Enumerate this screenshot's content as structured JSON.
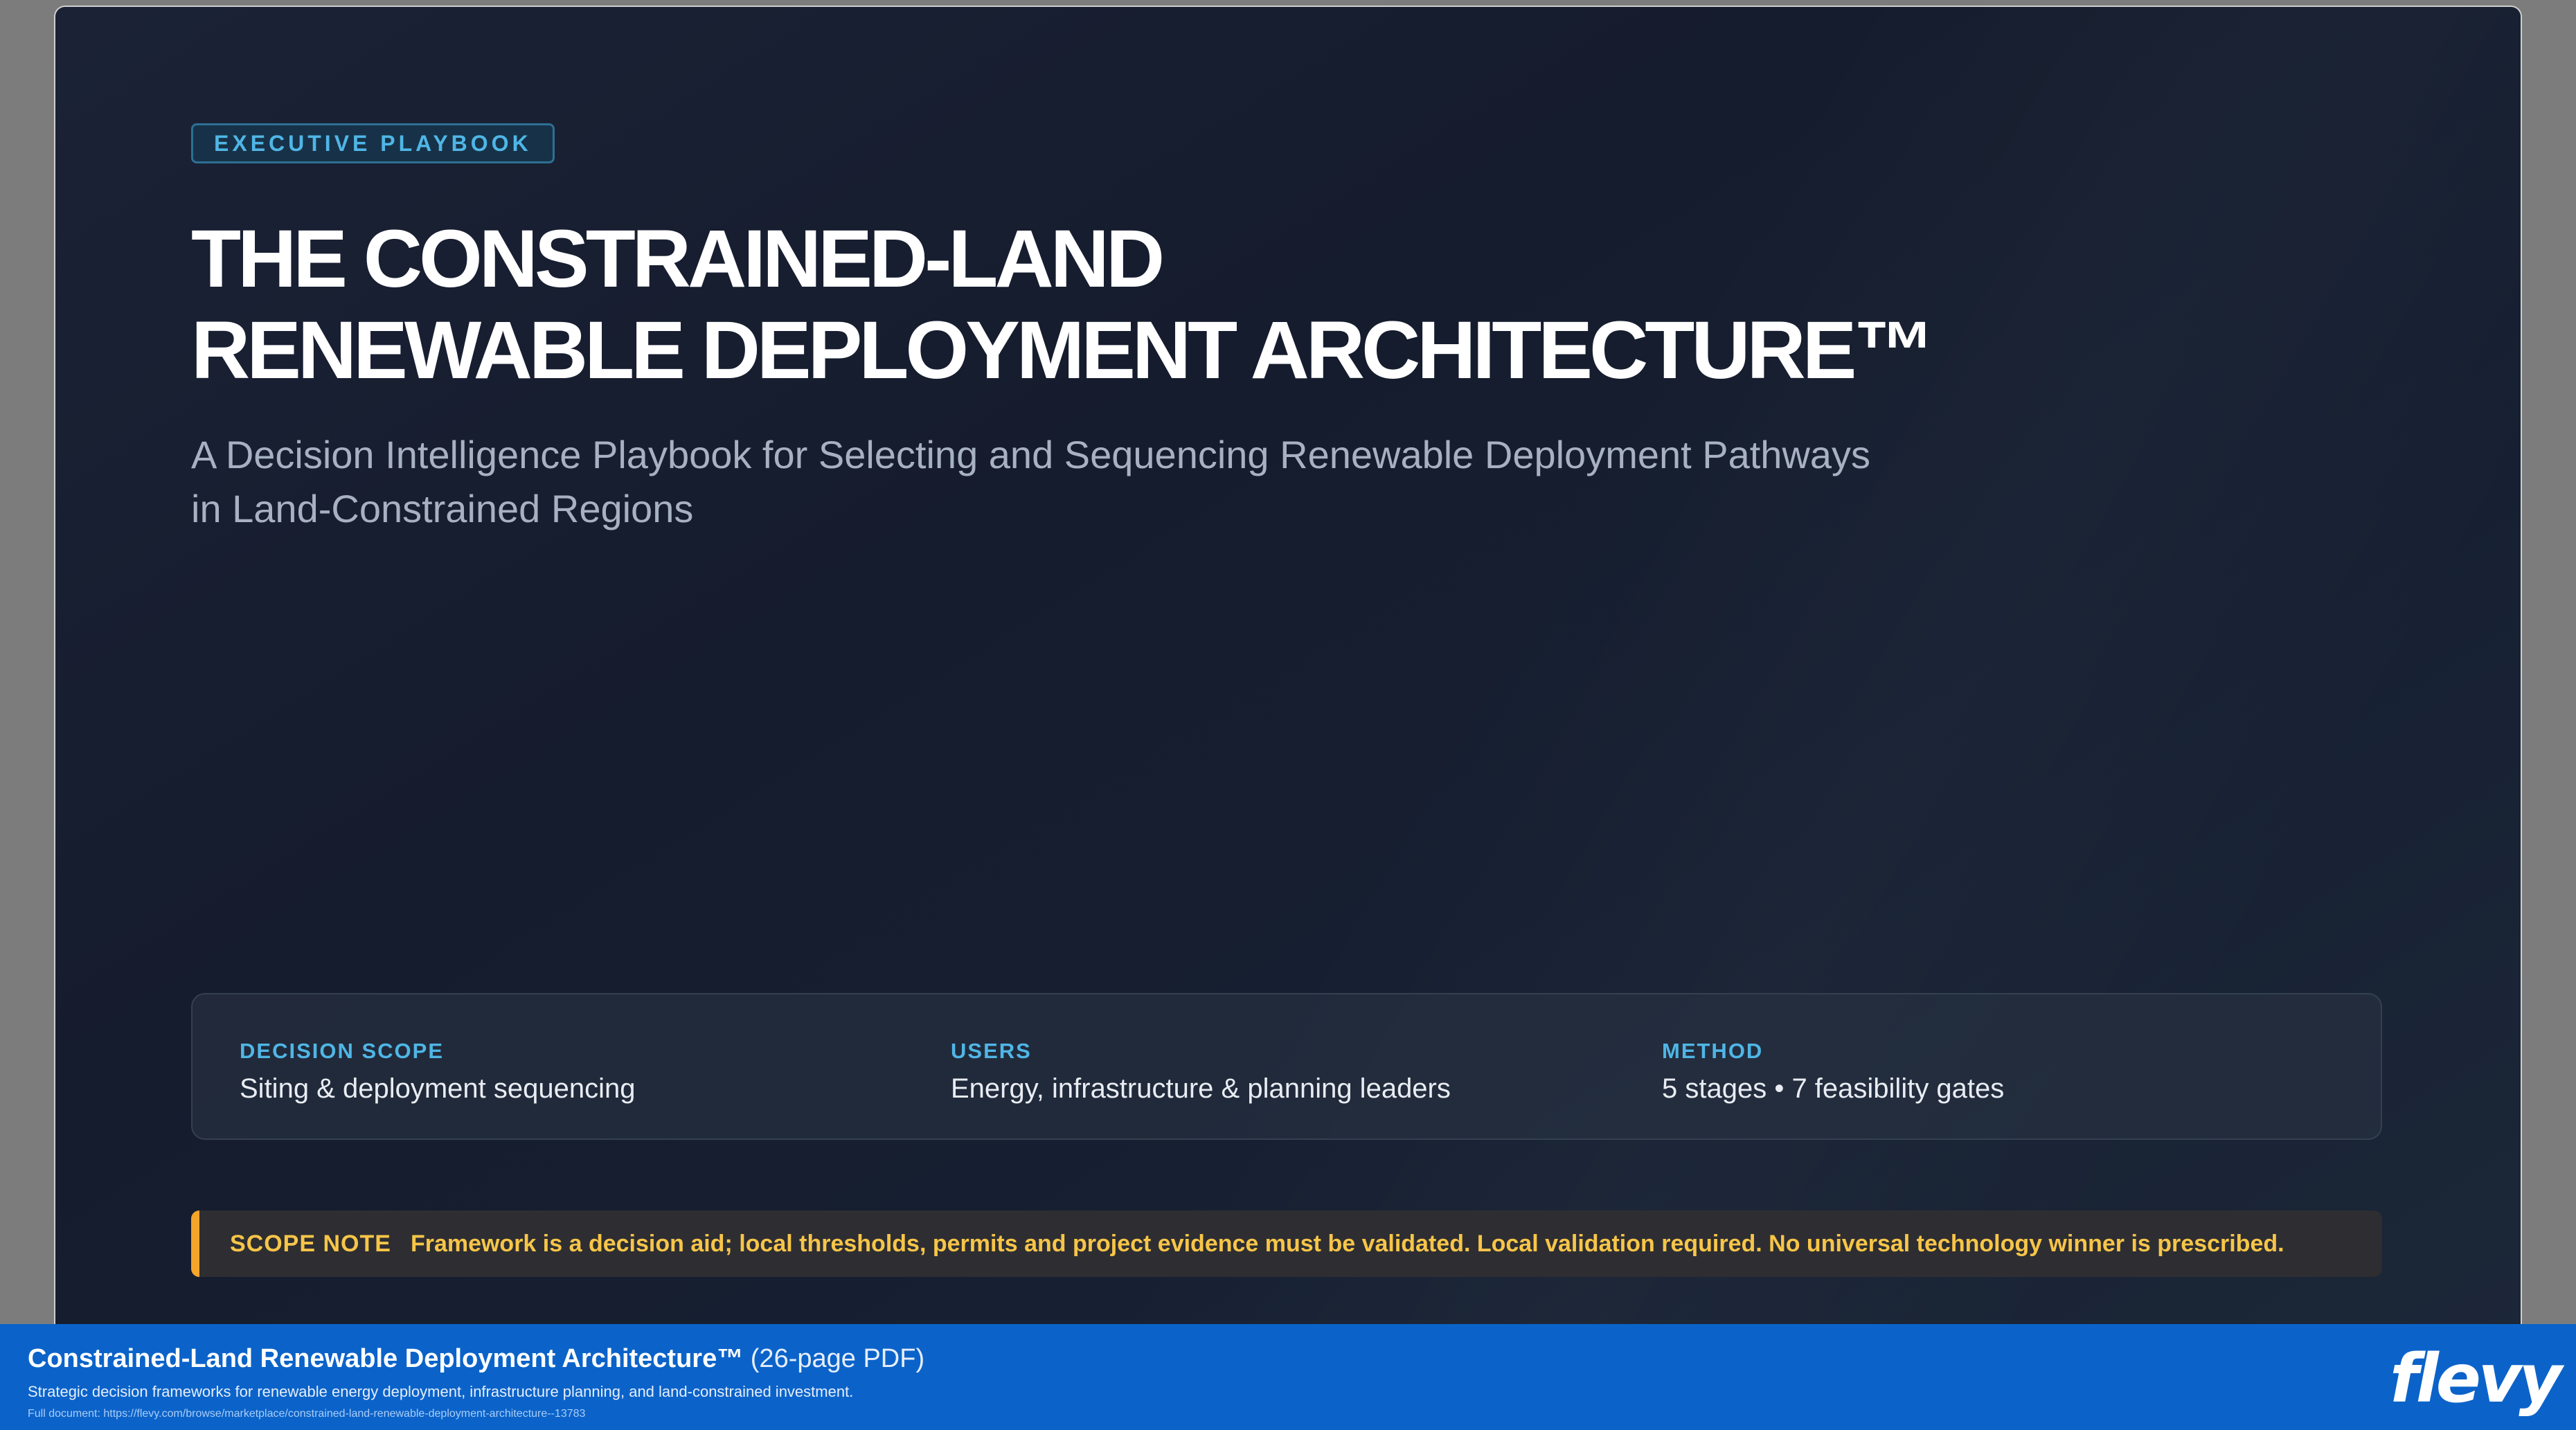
{
  "slide": {
    "badge": "EXECUTIVE PLAYBOOK",
    "title_lines": [
      "THE CONSTRAINED-LAND",
      "RENEWABLE DEPLOYMENT ARCHITECTURE™"
    ],
    "subtitle_lines": [
      "A Decision Intelligence Playbook for Selecting and Sequencing Renewable Deployment Pathways",
      "in Land-Constrained Regions"
    ],
    "info": [
      {
        "label": "DECISION SCOPE",
        "value": "Siting & deployment sequencing"
      },
      {
        "label": "USERS",
        "value": "Energy, infrastructure & planning leaders"
      },
      {
        "label": "METHOD",
        "value": "5 stages • 7 feasibility gates"
      }
    ],
    "scope_note": {
      "label": "SCOPE NOTE",
      "text": "Framework is a decision aid; local thresholds, permits and project evidence must be validated. Local validation required. No universal technology winner is prescribed."
    }
  },
  "footer": {
    "title": "Constrained-Land Renewable Deployment Architecture™",
    "pages": "(26-page PDF)",
    "description": "Strategic decision frameworks for renewable energy deployment, infrastructure planning, and land-constrained investment.",
    "link": "Full document: https://flevy.com/browse/marketplace/constrained-land-renewable-deployment-architecture--13783",
    "logo": "flevy"
  },
  "colors": {
    "accent": "#4fb6e6",
    "scope_note_text": "#f7c548",
    "scope_note_bar": "#f4a52a",
    "footer_bg": "#0b63c9",
    "slide_bg": "#161d2e"
  }
}
